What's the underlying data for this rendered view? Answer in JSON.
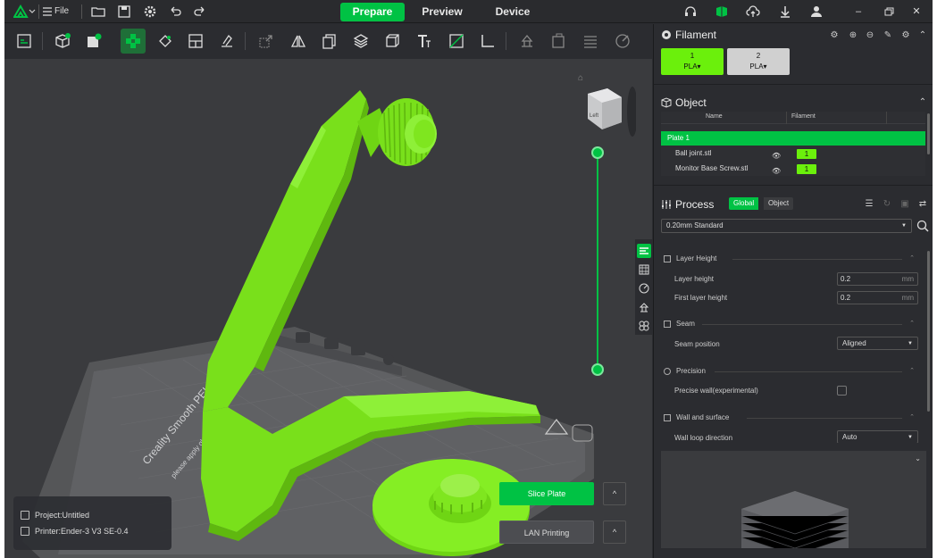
{
  "app": {
    "name": "Creality Print"
  },
  "colors": {
    "accent": "#00c244",
    "model": "#79e01b",
    "badge": "#6bf00c"
  },
  "titlebar": {
    "file_label": "File",
    "tabs": [
      {
        "label": "Prepare",
        "active": true
      },
      {
        "label": "Preview",
        "active": false
      },
      {
        "label": "Device",
        "active": false
      }
    ],
    "icons": [
      "menu-icon",
      "open-folder-icon",
      "save-icon",
      "settings-icon",
      "undo-icon",
      "redo-icon",
      "headset-icon",
      "model-store-icon",
      "upload-cloud-icon",
      "download-icon",
      "user-icon",
      "minimize-icon",
      "restore-icon",
      "close-icon"
    ]
  },
  "toolbar": {
    "tools": [
      "plate-icon",
      "add-object-icon",
      "add-plate-icon",
      "arrange-icon",
      "orient-icon",
      "layout-icon",
      "clean-icon",
      "scale-icon",
      "mirror-icon",
      "copy-icon",
      "layers-icon",
      "cube-icon",
      "text-icon",
      "cut-icon",
      "measure-icon",
      "support-icon",
      "seam-icon",
      "variable-layer-icon",
      "paint-icon"
    ]
  },
  "viewport": {
    "view_cube_label": "Left",
    "bed_text": "Creality Smooth PEI Pl...",
    "bed_text2": "please apply glue before...",
    "project": "Project:Untitled",
    "printer": "Printer:Ender-3 V3 SE-0.4",
    "slice_label": "Slice Plate",
    "lan_label": "LAN Printing",
    "arrow": "^"
  },
  "filament": {
    "title": "Filament",
    "items": [
      {
        "num": "1",
        "type": "PLA",
        "color": "#6bf00c"
      },
      {
        "num": "2",
        "type": "PLA",
        "color": "#d0d0d0"
      }
    ]
  },
  "object": {
    "title": "Object",
    "col_name": "Name",
    "col_filament": "Filament",
    "plate": "Plate 1",
    "rows": [
      {
        "name": "Ball joint.stl",
        "filament": "1"
      },
      {
        "name": "Monitor Base Screw.stl",
        "filament": "1"
      }
    ]
  },
  "process": {
    "title": "Process",
    "seg_global": "Global",
    "seg_object": "Object",
    "preset": "0.20mm Standard",
    "groups": {
      "layer_height": "Layer Height",
      "seam": "Seam",
      "precision": "Precision",
      "wall": "Wall and surface"
    },
    "options": {
      "layer_height_label": "Layer height",
      "layer_height_value": "0.2",
      "first_layer_label": "First layer height",
      "first_layer_value": "0.2",
      "unit": "mm",
      "seam_position_label": "Seam position",
      "seam_position_value": "Aligned",
      "precise_wall_label": "Precise wall(experimental)",
      "wall_loop_label": "Wall loop direction",
      "wall_loop_value": "Auto"
    }
  }
}
